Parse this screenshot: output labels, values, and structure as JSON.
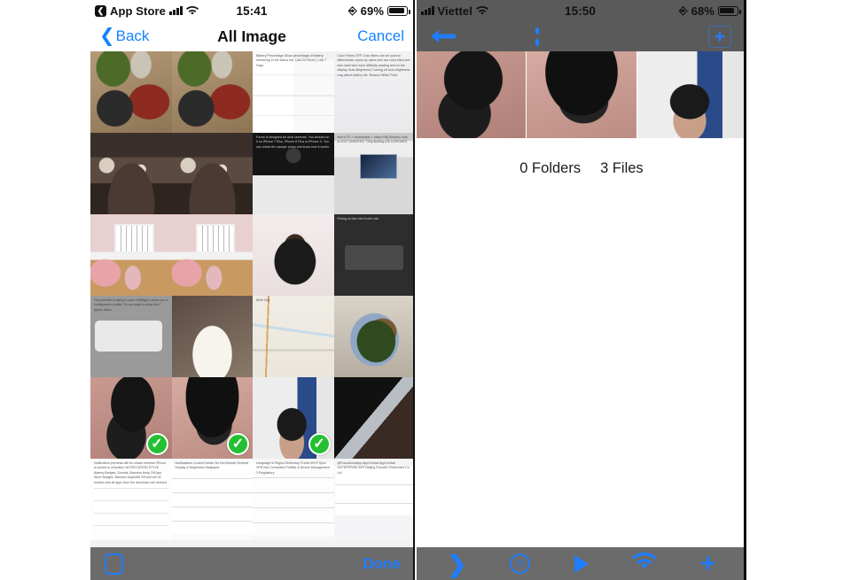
{
  "left_phone": {
    "status_bar": {
      "back_app": "App Store",
      "back_chevron_icon": "chevron-left-icon",
      "signal_icon": "cellular-bars-icon",
      "wifi_icon": "wifi-icon",
      "time": "15:41",
      "rotation_lock_icon": "rotation-lock-icon",
      "battery_percent": "69%",
      "battery_icon": "battery-icon",
      "battery_level": 69
    },
    "nav_bar": {
      "back_label": "Back",
      "back_icon": "chevron-left-icon",
      "title": "All Image",
      "cancel_label": "Cancel"
    },
    "bottom_bar": {
      "select_all_icon": "square-outline-icon",
      "done_label": "Done"
    },
    "grid": {
      "columns": 4,
      "selected_indices": [
        16,
        17,
        18
      ],
      "cells": [
        {
          "name": "photo-street-food-a",
          "art": "a-food1",
          "caption": ""
        },
        {
          "name": "photo-street-food-b",
          "art": "a-food1",
          "caption": ""
        },
        {
          "name": "screenshot-battery-settings",
          "art": "a-settings",
          "caption": "Battery Percentage    Show percentage of battery remaining in the status bar.    Last 24 Hours | Last 7 Days"
        },
        {
          "name": "screenshot-display-accessibility",
          "art": "a-settings-dark",
          "caption": "Color Filters   OFF    Color filters can be used to differentiate colors by users who are color blind and who want who have difficulty reading text on the display.    Auto-Brightness    Turning off auto-brightness may affect battery life.    Reduce White Point"
        },
        {
          "name": "photo-night-street-a",
          "art": "a-street",
          "caption": ""
        },
        {
          "name": "photo-night-street-b",
          "art": "a-street",
          "caption": ""
        },
        {
          "name": "screenshot-focos-app",
          "art": "a-darkvid",
          "caption": "Focos is designed for dual cameras. You should run it on iPhone 7 Plus, iPhone 8 Plus or iPhone X. You can check the sample photo and know how it works."
        },
        {
          "name": "screenshot-file-explorer",
          "art": "a-explorer",
          "caption": "Ben's PC  >  Downloads  >  Video        Fifty.Shades.Dark er.2017.UNRATED. 720p.BluRay.x26 4-DRONES"
        },
        {
          "name": "photo-pink-cafe-a",
          "art": "a-cafe",
          "caption": ""
        },
        {
          "name": "photo-pink-cafe-b",
          "art": "a-cafe",
          "caption": ""
        },
        {
          "name": "photo-chocolate-cake",
          "art": "a-cake",
          "caption": ""
        },
        {
          "name": "screenshot-no-preview",
          "art": "a-noprev",
          "caption": "Không có bản xem trước nào"
        },
        {
          "name": "screenshot-profile-alert",
          "art": "a-alert",
          "caption": "This website is trying to open Settings to show you a configuration profile. Do you want to allow this?        Ignore      Allow"
        },
        {
          "name": "photo-mango-bowl",
          "art": "a-mango",
          "caption": ""
        },
        {
          "name": "screenshot-map-ho-chi-minh",
          "art": "a-map",
          "caption": "Minh City"
        },
        {
          "name": "photo-veggie-bowl",
          "art": "a-bowl",
          "caption": ""
        },
        {
          "name": "photo-helmet-on-mat",
          "art": "a-helmet1",
          "caption": ""
        },
        {
          "name": "photo-helmet-closeup",
          "art": "a-helmet2",
          "caption": ""
        },
        {
          "name": "photo-selfie-with-helmet",
          "art": "a-selfie",
          "caption": ""
        },
        {
          "name": "photo-knife-on-table",
          "art": "a-knife",
          "caption": ""
        },
        {
          "name": "screenshot-notification-style",
          "art": "a-notif",
          "caption": "Notification previews will be shown whether iPhone is locked or unlocked.    NOTIFICATION STYLE    Alarmy  Badges, Sounds, Banners    Andy  Off    App Store  Badges, Banners    Asphalt8  Off    and will be trusted until all apps from the developer are deleted."
        },
        {
          "name": "screenshot-settings-list",
          "art": "a-notif2",
          "caption": "Notifications      Control Center      Do Not Disturb      General      Display & Brightness      Wallpaper"
        },
        {
          "name": "screenshot-general-list",
          "art": "a-lang",
          "caption": "Language & Region      Dictionary      iTunes Wi-Fi Sync      VPN     Not Connected      Profiles & Device Management   3      Regulatory"
        },
        {
          "name": "screenshot-device-management",
          "art": "a-apps",
          "caption": "@FoundAnotApp      AppCentral  AppCentral      ENTERPRISE APP      Beijing Founder Electronics Co Ltd"
        }
      ],
      "checkmark_icon": "checkmark-circle-icon",
      "checkmark_color": "#22c032"
    }
  },
  "right_phone": {
    "status_bar": {
      "signal_icon": "cellular-bars-icon",
      "carrier": "Viettel",
      "wifi_icon": "wifi-icon",
      "time": "15:50",
      "rotation_lock_icon": "rotation-lock-icon",
      "battery_percent": "68%",
      "battery_icon": "battery-icon",
      "battery_level": 68
    },
    "top_toolbar": {
      "items": [
        {
          "name": "back-arrow-button",
          "icon": "arrow-left-icon"
        },
        {
          "name": "split-view-button",
          "icon": "split-panes-icon"
        },
        {
          "name": "list-view-button",
          "icon": "list-lines-icon"
        },
        {
          "name": "add-button",
          "icon": "plus-boxed-icon"
        }
      ]
    },
    "thumbnails": [
      {
        "name": "thumb-helmet-on-mat",
        "art": "a-helmet1"
      },
      {
        "name": "thumb-helmet-closeup",
        "art": "a-helmet2"
      },
      {
        "name": "thumb-selfie-with-helmet",
        "art": "a-selfie"
      }
    ],
    "summary": {
      "folders": "0 Folders",
      "files": "3 Files"
    },
    "bottom_toolbar": {
      "items": [
        {
          "name": "transfer-button",
          "icon": "chevron-right-icon"
        },
        {
          "name": "search-button",
          "icon": "magnifier-circle-icon"
        },
        {
          "name": "play-button",
          "icon": "play-triangle-icon"
        },
        {
          "name": "wifi-button",
          "icon": "wifi-icon"
        },
        {
          "name": "add-button",
          "icon": "plus-icon"
        }
      ]
    }
  },
  "theme": {
    "ios_blue": "#1f7dff",
    "toolbar_gray": "#6b6b6b",
    "statusbar_gray": "#5a5a5a",
    "check_green": "#22c032",
    "page_bg": "#ffffff"
  }
}
